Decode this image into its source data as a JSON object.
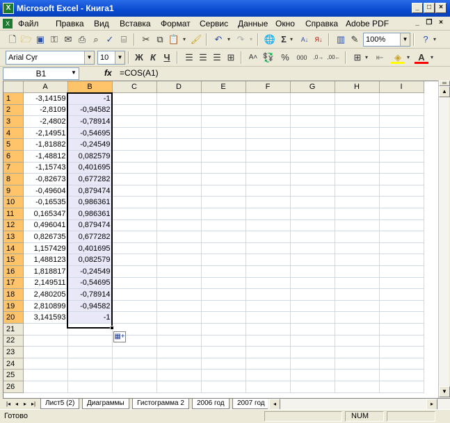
{
  "window": {
    "title": "Microsoft Excel - Книга1",
    "app_icon": "X"
  },
  "menu": [
    "Файл",
    "Правка",
    "Вид",
    "Вставка",
    "Формат",
    "Сервис",
    "Данные",
    "Окно",
    "Справка",
    "Adobe PDF"
  ],
  "toolbar": {
    "zoom": "100%",
    "font": "Arial Cyr",
    "size": "10"
  },
  "formula_bar": {
    "cell": "B1",
    "fx": "fx",
    "formula": "=COS(A1)"
  },
  "columns": [
    "A",
    "B",
    "C",
    "D",
    "E",
    "F",
    "G",
    "H",
    "I"
  ],
  "rows": [
    {
      "n": "1",
      "a": "-3,14159",
      "b": "-1"
    },
    {
      "n": "2",
      "a": "-2,8109",
      "b": "-0,94582"
    },
    {
      "n": "3",
      "a": "-2,4802",
      "b": "-0,78914"
    },
    {
      "n": "4",
      "a": "-2,14951",
      "b": "-0,54695"
    },
    {
      "n": "5",
      "a": "-1,81882",
      "b": "-0,24549"
    },
    {
      "n": "6",
      "a": "-1,48812",
      "b": "0,082579"
    },
    {
      "n": "7",
      "a": "-1,15743",
      "b": "0,401695"
    },
    {
      "n": "8",
      "a": "-0,82673",
      "b": "0,677282"
    },
    {
      "n": "9",
      "a": "-0,49604",
      "b": "0,879474"
    },
    {
      "n": "10",
      "a": "-0,16535",
      "b": "0,986361"
    },
    {
      "n": "11",
      "a": "0,165347",
      "b": "0,986361"
    },
    {
      "n": "12",
      "a": "0,496041",
      "b": "0,879474"
    },
    {
      "n": "13",
      "a": "0,826735",
      "b": "0,677282"
    },
    {
      "n": "14",
      "a": "1,157429",
      "b": "0,401695"
    },
    {
      "n": "15",
      "a": "1,488123",
      "b": "0,082579"
    },
    {
      "n": "16",
      "a": "1,818817",
      "b": "-0,24549"
    },
    {
      "n": "17",
      "a": "2,149511",
      "b": "-0,54695"
    },
    {
      "n": "18",
      "a": "2,480205",
      "b": "-0,78914"
    },
    {
      "n": "19",
      "a": "2,810899",
      "b": "-0,94582"
    },
    {
      "n": "20",
      "a": "3,141593",
      "b": "-1"
    },
    {
      "n": "21",
      "a": "",
      "b": ""
    },
    {
      "n": "22",
      "a": "",
      "b": ""
    },
    {
      "n": "23",
      "a": "",
      "b": ""
    },
    {
      "n": "24",
      "a": "",
      "b": ""
    },
    {
      "n": "25",
      "a": "",
      "b": ""
    },
    {
      "n": "26",
      "a": "",
      "b": ""
    }
  ],
  "sheets": [
    "Лист5 (2)",
    "Диаграммы",
    "Гистограмма 2",
    "2006 год",
    "2007 год"
  ],
  "status": {
    "text": "Готово",
    "num": "NUM"
  }
}
